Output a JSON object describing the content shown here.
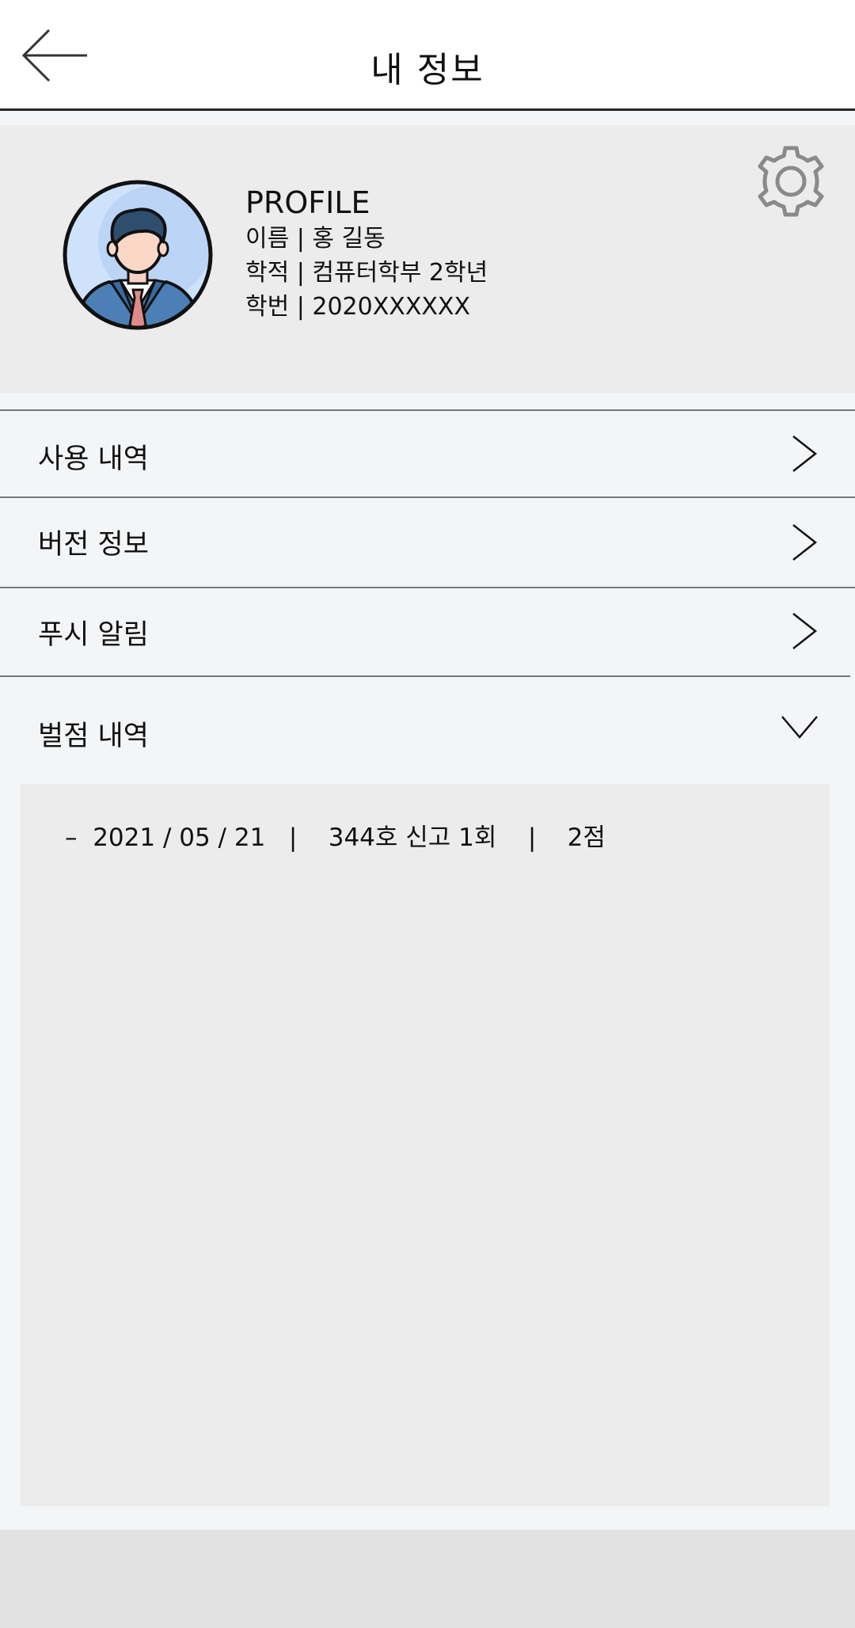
{
  "header": {
    "title": "내 정보",
    "back_icon": "arrow-left-icon"
  },
  "profile": {
    "label": "PROFILE",
    "name_line": "이름 | 홍 길동",
    "dept_line": "학적 | 컴퓨터학부 2학년",
    "id_line": "학번 |  2020XXXXXX",
    "avatar_icon": "user-avatar-icon",
    "settings_icon": "gear-icon"
  },
  "menu": {
    "usage": "사용 내역",
    "version": "버전 정보",
    "push": "푸시 알림",
    "penalty": "벌점 내역"
  },
  "penalty": {
    "records": [
      {
        "text": "–  2021 / 05 / 21   |    344호 신고 1회    |    2점"
      }
    ]
  }
}
